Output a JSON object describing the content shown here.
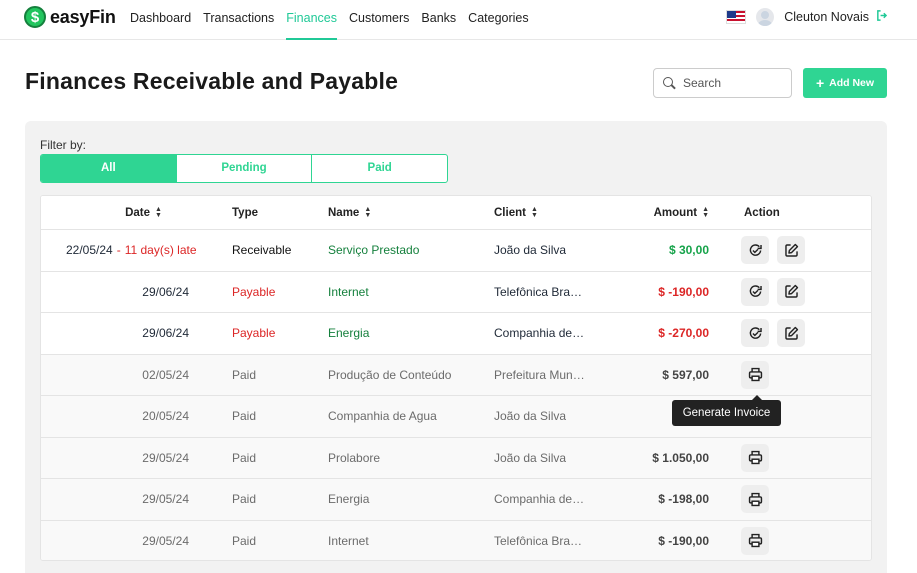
{
  "app": {
    "logo_symbol": "$",
    "name": "easyFin"
  },
  "nav": [
    {
      "label": "Dashboard",
      "active": false
    },
    {
      "label": "Transactions",
      "active": false
    },
    {
      "label": "Finances",
      "active": true
    },
    {
      "label": "Customers",
      "active": false
    },
    {
      "label": "Banks",
      "active": false
    },
    {
      "label": "Categories",
      "active": false
    }
  ],
  "user": {
    "name": "Cleuton Novais",
    "locale_flag": "us-flag-icon"
  },
  "page": {
    "title": "Finances Receivable and Payable",
    "search_placeholder": "Search",
    "add_button": "Add New"
  },
  "filter": {
    "label": "Filter by:",
    "options": [
      "All",
      "Pending",
      "Paid"
    ],
    "selected": "All"
  },
  "table": {
    "headers": {
      "date": "Date",
      "type": "Type",
      "name": "Name",
      "client": "Client",
      "amount": "Amount",
      "action": "Action"
    },
    "rows": [
      {
        "date": "22/05/24",
        "late_sep": "-",
        "late": "11 day(s) late",
        "type": "Receivable",
        "name": "Serviço Prestado",
        "client": "João da Silva",
        "amount": "$ 30,00",
        "status": "pending"
      },
      {
        "date": "29/06/24",
        "late_sep": "",
        "late": "",
        "type": "Payable",
        "name": "Internet",
        "client": "Telefônica Bras…",
        "amount": "$ -190,00",
        "status": "pending"
      },
      {
        "date": "29/06/24",
        "late_sep": "",
        "late": "",
        "type": "Payable",
        "name": "Energia",
        "client": "Companhia de En…",
        "amount": "$ -270,00",
        "status": "pending"
      },
      {
        "date": "02/05/24",
        "late_sep": "",
        "late": "",
        "type": "Paid",
        "name": "Produção de Conteúdo",
        "client": "Prefeitura Muni…",
        "amount": "$ 597,00",
        "status": "paid"
      },
      {
        "date": "20/05/24",
        "late_sep": "",
        "late": "",
        "type": "Paid",
        "name": "Companhia de Agua",
        "client": "João da Silva",
        "amount": "",
        "status": "paid"
      },
      {
        "date": "29/05/24",
        "late_sep": "",
        "late": "",
        "type": "Paid",
        "name": "Prolabore",
        "client": "João da Silva",
        "amount": "$ 1.050,00",
        "status": "paid"
      },
      {
        "date": "29/05/24",
        "late_sep": "",
        "late": "",
        "type": "Paid",
        "name": "Energia",
        "client": "Companhia de En…",
        "amount": "$ -198,00",
        "status": "paid"
      },
      {
        "date": "29/05/24",
        "late_sep": "",
        "late": "",
        "type": "Paid",
        "name": "Internet",
        "client": "Telefônica Bras…",
        "amount": "$ -190,00",
        "status": "paid"
      }
    ]
  },
  "tooltip": {
    "text": "Generate Invoice"
  },
  "colors": {
    "accent": "#2fd593",
    "danger": "#dc2626",
    "success": "#16a34a"
  }
}
